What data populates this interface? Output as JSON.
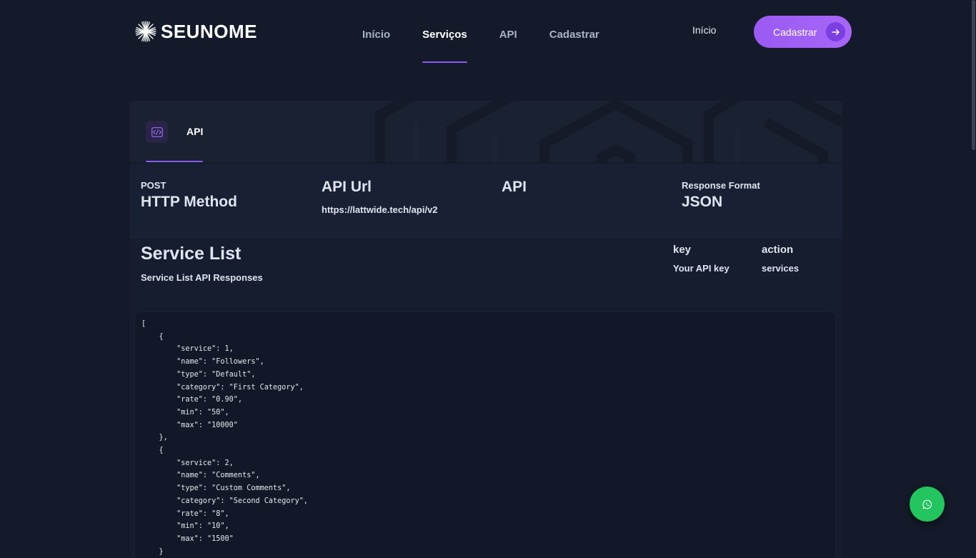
{
  "brand": {
    "name": "SEUNOME",
    "logo_icon": "starburst-logo-icon"
  },
  "nav": {
    "items": [
      {
        "label": "Início",
        "active": false
      },
      {
        "label": "Serviços",
        "active": true
      },
      {
        "label": "API",
        "active": false
      },
      {
        "label": "Cadastrar",
        "active": false
      }
    ],
    "right_link": "Início",
    "cta_label": "Cadastrar",
    "cta_icon": "arrow-right-icon"
  },
  "card": {
    "tab": {
      "label": "API",
      "icon": "code-icon"
    },
    "info": {
      "method_value": "POST",
      "method_label": "HTTP Method",
      "url_label": "API Url",
      "url_value": "https://lattwide.tech/api/v2",
      "api_label": "API",
      "format_label": "Response Format",
      "format_value": "JSON"
    },
    "service_list": {
      "title": "Service List",
      "subtitle": "Service List API Responses",
      "params": [
        {
          "key": "key",
          "value": "Your API key"
        },
        {
          "key": "action",
          "value": "services"
        }
      ]
    },
    "code": "[\n    {\n        \"service\": 1,\n        \"name\": \"Followers\",\n        \"type\": \"Default\",\n        \"category\": \"First Category\",\n        \"rate\": \"0.90\",\n        \"min\": \"50\",\n        \"max\": \"10000\"\n    },\n    {\n        \"service\": 2,\n        \"name\": \"Comments\",\n        \"type\": \"Custom Comments\",\n        \"category\": \"Second Category\",\n        \"rate\": \"8\",\n        \"min\": \"10\",\n        \"max\": \"1500\"\n    }\n]"
  },
  "fab": {
    "icon": "whatsapp-icon"
  },
  "colors": {
    "background": "#141a29",
    "accent": "#8b5cf6",
    "cta": "#9b5cf6",
    "whatsapp": "#22c55e"
  }
}
